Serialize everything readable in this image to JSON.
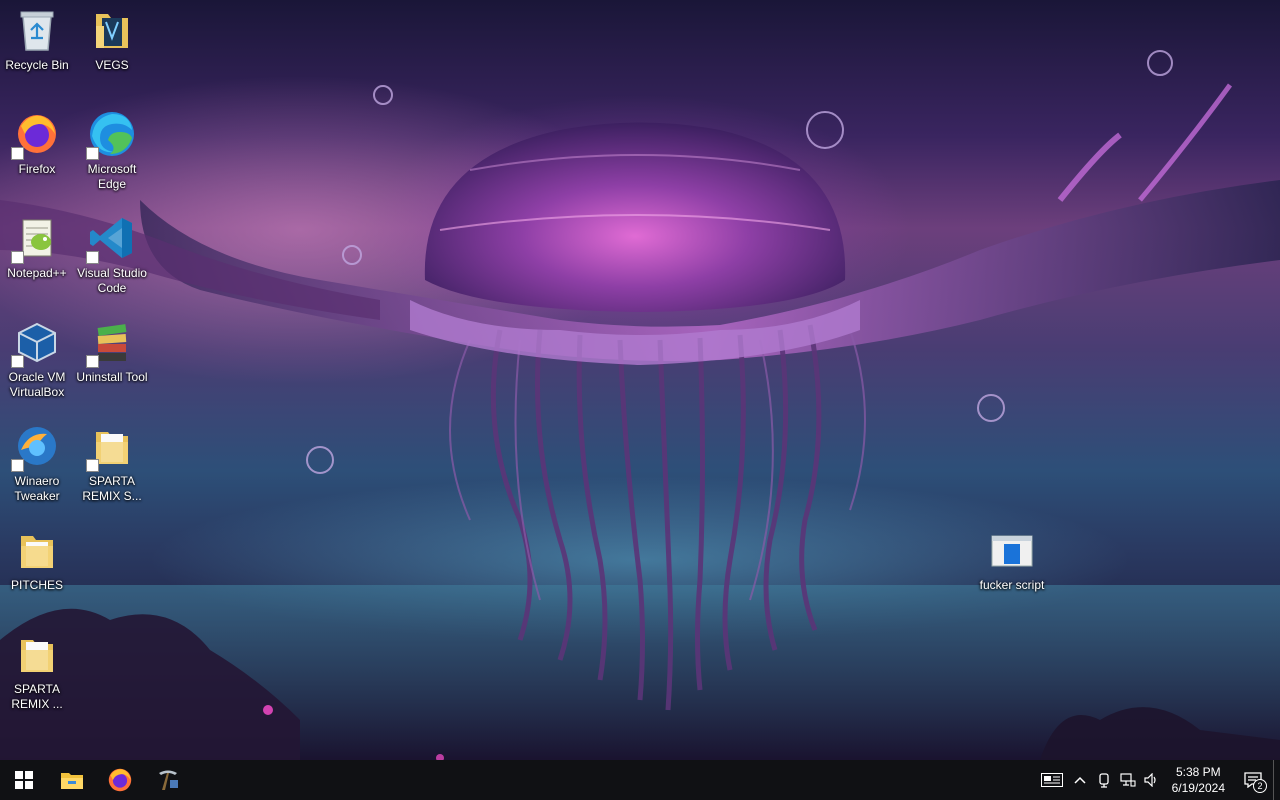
{
  "desktop": {
    "icons": [
      {
        "label": "Recycle Bin",
        "icon": "recycle-bin-icon"
      },
      {
        "label": "VEGS",
        "icon": "folder-icon"
      },
      {
        "label": "Firefox",
        "icon": "firefox-icon"
      },
      {
        "label": "Microsoft Edge",
        "icon": "edge-icon"
      },
      {
        "label": "Notepad++",
        "icon": "notepadpp-icon"
      },
      {
        "label": "Visual Studio Code",
        "icon": "vscode-icon"
      },
      {
        "label": "Oracle VM VirtualBox",
        "icon": "virtualbox-icon"
      },
      {
        "label": "Uninstall Tool",
        "icon": "uninstall-tool-icon"
      },
      {
        "label": "Winaero Tweaker",
        "icon": "winaero-icon"
      },
      {
        "label": "SPARTA REMIX S...",
        "icon": "folder-icon"
      },
      {
        "label": "PITCHES",
        "icon": "folder-icon"
      },
      {
        "label": "SPARTA REMIX ...",
        "icon": "folder-icon"
      },
      {
        "label": "fucker script",
        "icon": "script-file-icon"
      }
    ]
  },
  "taskbar": {
    "pinned": [
      {
        "name": "Start",
        "icon": "windows-start-icon"
      },
      {
        "name": "File Explorer",
        "icon": "file-explorer-icon"
      },
      {
        "name": "Firefox",
        "icon": "firefox-icon"
      },
      {
        "name": "Pickaxe app",
        "icon": "pickaxe-icon"
      }
    ],
    "tray": {
      "icons": [
        "news-widget-icon",
        "chevron-up-icon",
        "meet-now-icon",
        "network-icon",
        "volume-icon"
      ],
      "time": "5:38 PM",
      "date": "6/19/2024",
      "notification_count": "2"
    }
  },
  "colors": {
    "taskbar_bg": "#101114",
    "folder_yellow": "#e8c25a",
    "edge_blue": "#1e8ee0",
    "vscode_blue": "#2489ca"
  }
}
